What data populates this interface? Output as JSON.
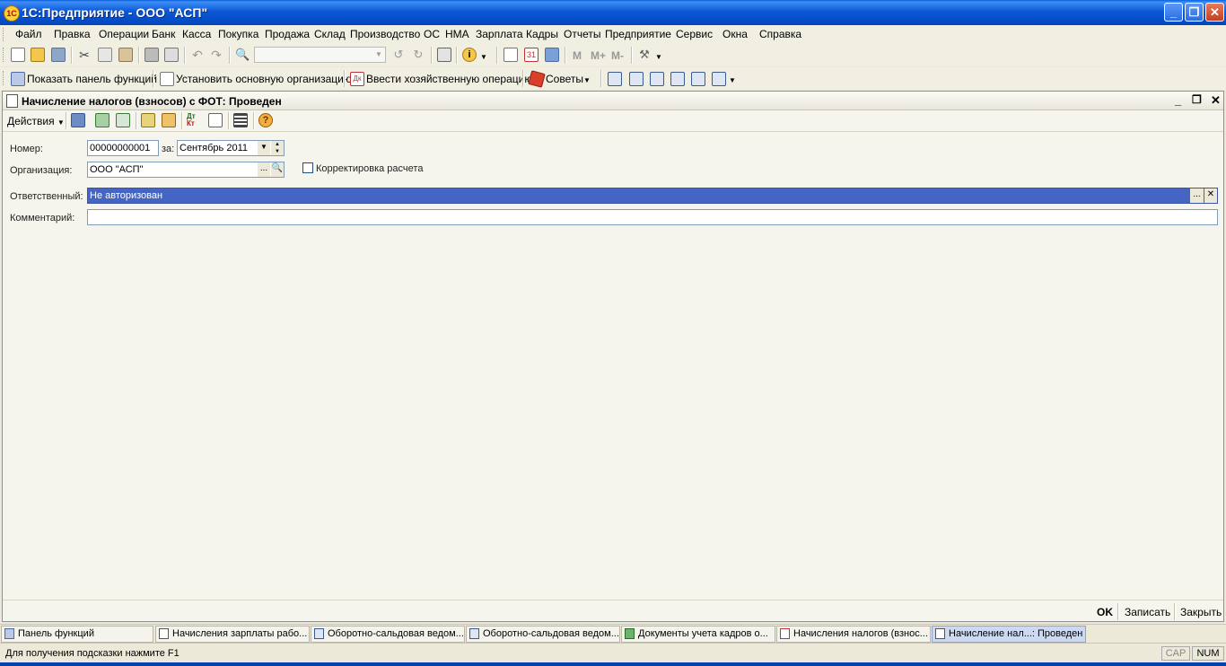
{
  "window": {
    "title": "1С:Предприятие - ООО \"АСП\"",
    "app_icon": "1c-logo-icon"
  },
  "menu": [
    "Файл",
    "Правка",
    "Операции",
    "Банк",
    "Касса",
    "Покупка",
    "Продажа",
    "Склад",
    "Производство",
    "ОС",
    "НМА",
    "Зарплата",
    "Кадры",
    "Отчеты",
    "Предприятие",
    "Сервис",
    "Окна",
    "Справка"
  ],
  "toolbar2": {
    "show_panel": "Показать панель функций",
    "set_org": "Установить основную организацию",
    "enter_op": "Ввести хозяйственную операцию",
    "tips": "Советы",
    "m": "M",
    "m_plus": "M+",
    "m_minus": "M-"
  },
  "document": {
    "title": "Начисление налогов (взносов) с ФОТ: Проведен",
    "actions": "Действия",
    "fields": {
      "number_label": "Номер:",
      "number_value": "00000000001",
      "for_label": "за:",
      "period_value": "Сентябрь 2011",
      "org_label": "Организация:",
      "org_value": "ООО \"АСП\"",
      "correction_label": "Корректировка расчета",
      "correction_checked": false,
      "responsible_label": "Ответственный:",
      "responsible_value": "Не авторизован",
      "comment_label": "Комментарий:",
      "comment_value": ""
    },
    "footer": {
      "ok": "OK",
      "save": "Записать",
      "close": "Закрыть"
    }
  },
  "taskbar": [
    "Панель функций",
    "Начисления зарплаты рабо...",
    "Оборотно-сальдовая ведом...",
    "Оборотно-сальдовая ведом...",
    "Документы учета кадров о...",
    "Начисления налогов (взнос...",
    "Начисление нал...: Проведен"
  ],
  "status": {
    "hint": "Для получения подсказки нажмите F1",
    "cap": "CAP",
    "num": "NUM"
  },
  "colors": {
    "titlebar": "#0b58d6",
    "selection": "#4565c4",
    "background": "#ece9d8"
  }
}
